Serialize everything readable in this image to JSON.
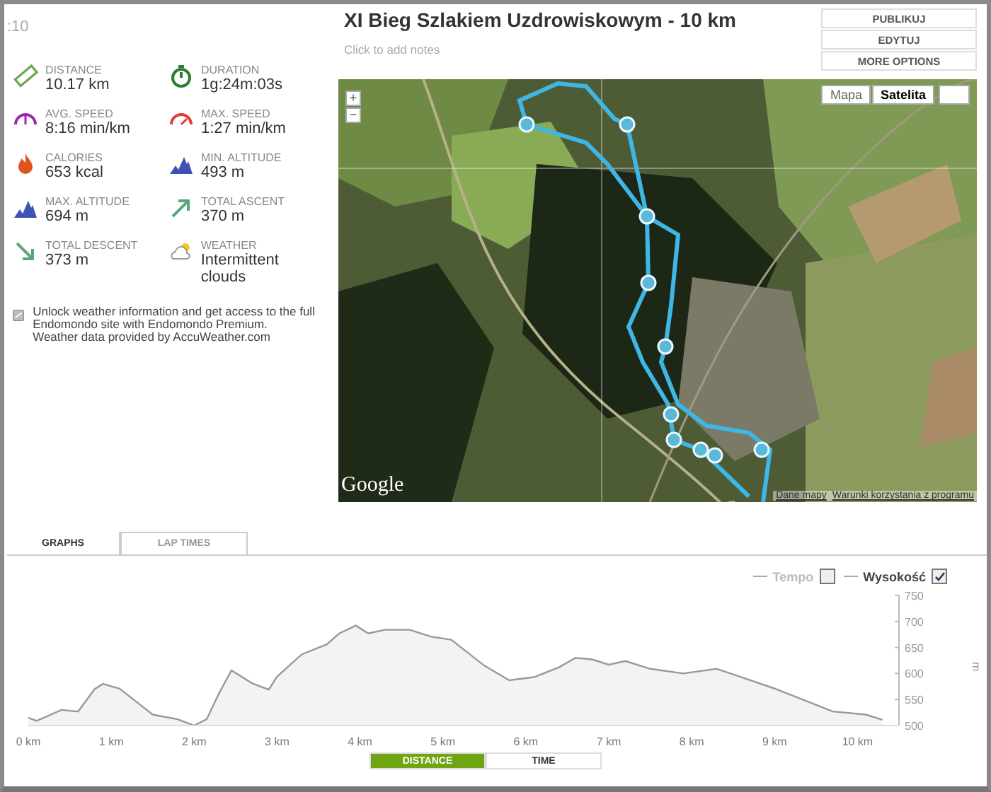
{
  "corner_text": ":10",
  "stats": [
    {
      "kind": "distance",
      "label": "DISTANCE",
      "value": "10.17 km"
    },
    {
      "kind": "duration",
      "label": "DURATION",
      "value": "1g:24m:03s"
    },
    {
      "kind": "avg_speed",
      "label": "AVG. SPEED",
      "value": "8:16 min/km"
    },
    {
      "kind": "max_speed",
      "label": "MAX. SPEED",
      "value": "1:27 min/km"
    },
    {
      "kind": "calories",
      "label": "CALORIES",
      "value": "653 kcal"
    },
    {
      "kind": "altitude",
      "label": "MIN. ALTITUDE",
      "value": "493 m"
    },
    {
      "kind": "altitude",
      "label": "MAX. ALTITUDE",
      "value": "694 m"
    },
    {
      "kind": "ascent",
      "label": "TOTAL ASCENT",
      "value": "370 m"
    },
    {
      "kind": "descent",
      "label": "TOTAL DESCENT",
      "value": "373 m"
    },
    {
      "kind": "weather",
      "label": "WEATHER",
      "value": "Intermittent clouds"
    }
  ],
  "premium_note": "Unlock weather information and get access to the full Endomondo site with Endomondo Premium.",
  "weather_credit": "Weather data provided by AccuWeather.com",
  "title": "XI Bieg Szlakiem Uzdrowiskowym - 10 km",
  "notes": {
    "placeholder": "Click to add notes"
  },
  "actions": [
    "PUBLIKUJ",
    "EDYTUJ",
    "MORE OPTIONS"
  ],
  "map": {
    "kind": "picture",
    "map_types": [
      {
        "label": "Mapa",
        "selected": false
      },
      {
        "label": "Satelita",
        "selected": true
      }
    ],
    "zoom_in": "+",
    "zoom_out": "−",
    "logo": "Google",
    "attribution": [
      "Dane mapy",
      "Warunki korzystania z programu"
    ]
  },
  "tabs": [
    {
      "label": "GRAPHS",
      "selected": true
    },
    {
      "label": "LAP TIMES",
      "selected": false
    }
  ],
  "legend": [
    {
      "label": "Tempo",
      "checked": false
    },
    {
      "checked": true
    }
  ],
  "chart_data": {
    "type": "area",
    "ylabel": "m",
    "xlim": [
      0,
      10.5
    ],
    "ylim": [
      500,
      750
    ],
    "xticks": [
      {
        "value": 0,
        "label": "0 km"
      },
      {
        "value": 1,
        "label": "1 km"
      },
      {
        "value": 2,
        "label": "2 km"
      },
      {
        "value": 3,
        "label": "3 km"
      },
      {
        "value": 4,
        "label": "4 km"
      },
      {
        "value": 5,
        "label": "5 km"
      },
      {
        "value": 6,
        "label": "6 km"
      },
      {
        "value": 7,
        "label": "7 km"
      },
      {
        "value": 8,
        "label": "8 km"
      },
      {
        "value": 9,
        "label": "9 km"
      },
      {
        "value": 10,
        "label": "10 km"
      }
    ],
    "yticks": [
      500,
      550,
      600,
      650,
      700,
      750
    ],
    "x": [
      0,
      0.1,
      0.4,
      0.6,
      0.8,
      0.9,
      1.1,
      1.3,
      1.5,
      1.8,
      2.0,
      2.15,
      2.3,
      2.45,
      2.7,
      2.9,
      3.0,
      3.3,
      3.6,
      3.75,
      3.95,
      4.1,
      4.3,
      4.6,
      4.85,
      5.1,
      5.5,
      5.8,
      6.1,
      6.4,
      6.6,
      6.8,
      7.0,
      7.2,
      7.5,
      7.9,
      8.3,
      8.6,
      9.0,
      9.4,
      9.7,
      10.1,
      10.3
    ],
    "series": [
      {
        "name": "Wysokość",
        "color": "#999999",
        "values": [
          515,
          509,
          530,
          527,
          570,
          580,
          571,
          546,
          521,
          512,
          500,
          512,
          562,
          606,
          581,
          569,
          594,
          637,
          656,
          677,
          692,
          677,
          684,
          684,
          671,
          665,
          615,
          587,
          593,
          612,
          630,
          627,
          617,
          624,
          609,
          600,
          609,
          593,
          571,
          546,
          527,
          521,
          511
        ]
      }
    ]
  },
  "x_modes": [
    {
      "label": "DISTANCE",
      "selected": true
    },
    {
      "label": "TIME",
      "selected": false
    }
  ]
}
